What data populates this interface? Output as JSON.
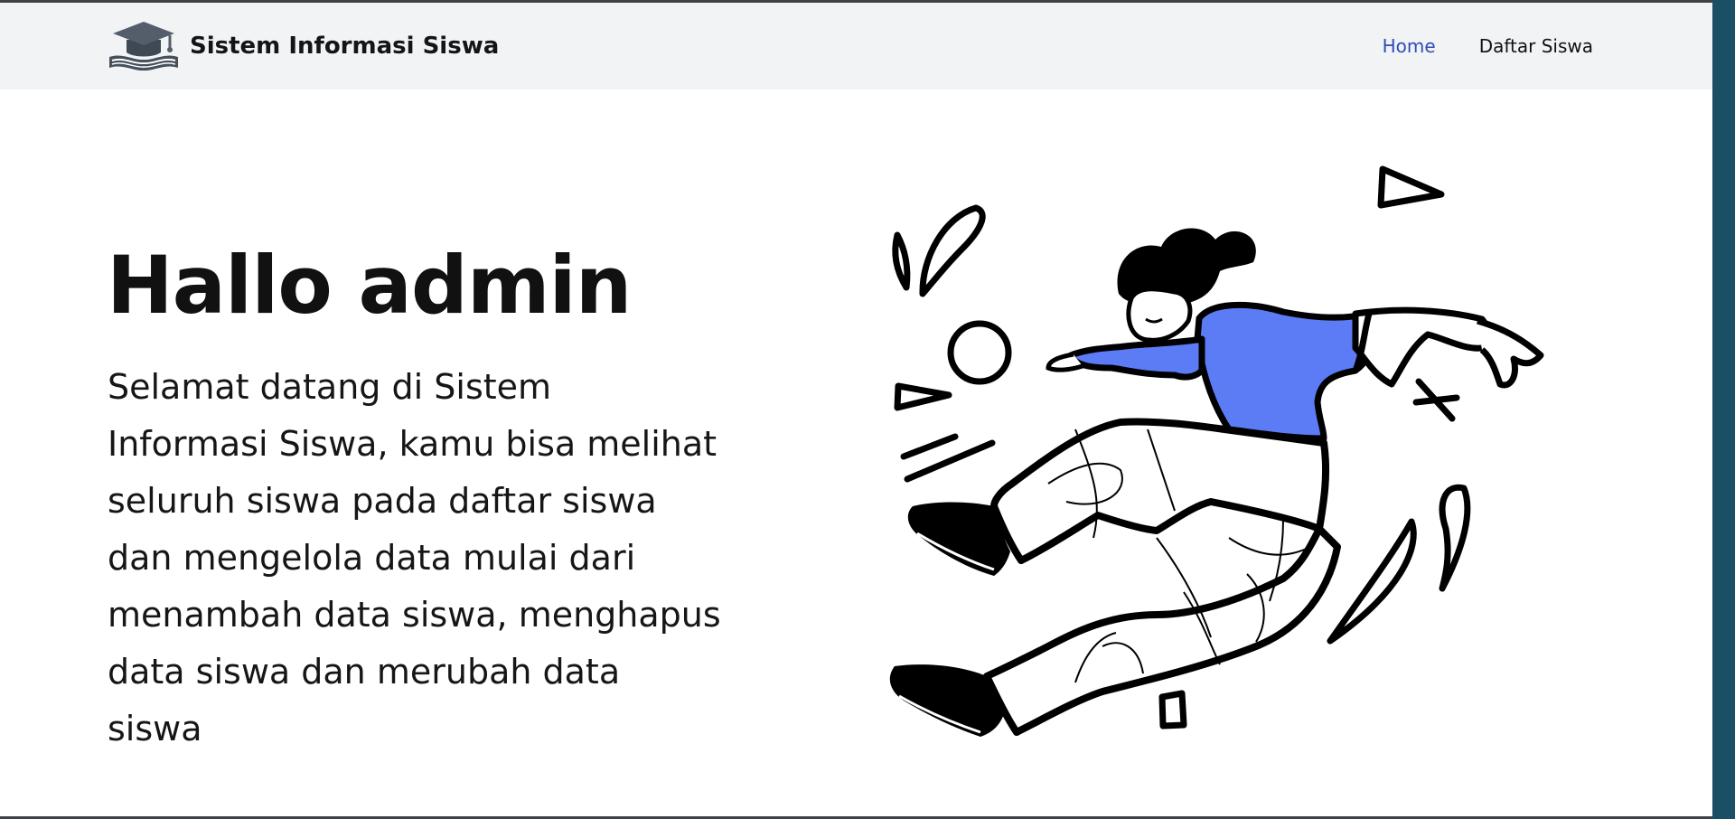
{
  "navbar": {
    "brand_name": "Sistem Informasi Siswa",
    "brand_icon": "graduation-cap-on-books-icon",
    "links": [
      {
        "label": "Home",
        "active": true
      },
      {
        "label": "Daftar Siswa",
        "active": false
      }
    ]
  },
  "hero": {
    "title": "Hallo admin",
    "description": "Selamat datang di Sistem Informasi Siswa, kamu bisa melihat seluruh siswa pada daftar siswa dan mengelola data mulai dari menambah data siswa, menghapus data siswa dan merubah data siswa",
    "illustration": "jumping-person-illustration"
  },
  "colors": {
    "navbar_bg": "#f2f3f5",
    "link_active": "#2e4db8",
    "illustration_accent": "#5b7cf5",
    "right_edge": "#1b4f66"
  }
}
